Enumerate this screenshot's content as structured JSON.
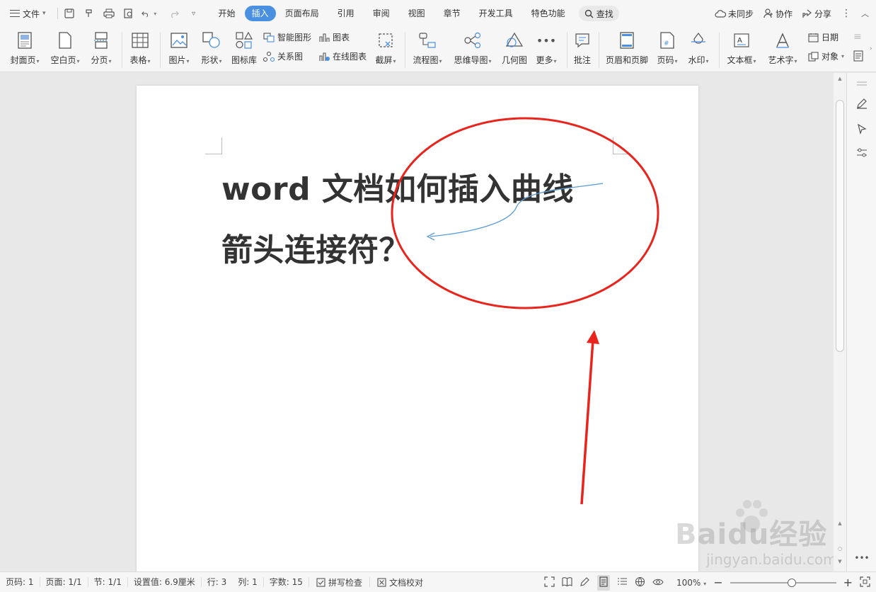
{
  "menubar": {
    "file_label": "文件",
    "tabs": [
      {
        "label": "开始"
      },
      {
        "label": "插入"
      },
      {
        "label": "页面布局"
      },
      {
        "label": "引用"
      },
      {
        "label": "审阅"
      },
      {
        "label": "视图"
      },
      {
        "label": "章节"
      },
      {
        "label": "开发工具"
      },
      {
        "label": "特色功能"
      }
    ],
    "active_tab": "插入",
    "search_label": "查找",
    "sync_label": "未同步",
    "collab_label": "协作",
    "share_label": "分享"
  },
  "ribbon": {
    "cover_page": "封面页",
    "blank_page": "空白页",
    "page_break": "分页",
    "table": "表格",
    "picture": "图片",
    "shape": "形状",
    "icon_library": "图标库",
    "smart_graphic": "智能图形",
    "relation_chart": "关系图",
    "chart": "图表",
    "online_chart": "在线图表",
    "screenshot": "截屏",
    "flowchart": "流程图",
    "mindmap": "思维导图",
    "geometry": "几何图",
    "more": "更多",
    "comment": "批注",
    "header_footer": "页眉和页脚",
    "page_number": "页码",
    "watermark": "水印",
    "textbox": "文本框",
    "wordart": "艺术字",
    "date": "日期",
    "object": "对象"
  },
  "document": {
    "line1": "word 文档如何插入曲线",
    "line2": "箭头连接符？"
  },
  "statusbar": {
    "page_num": "页码: 1",
    "pages": "页面: 1/1",
    "section": "节: 1/1",
    "setting": "设置值: 6.9厘米",
    "row": "行: 3",
    "col": "列: 1",
    "word_count": "字数: 15",
    "spell_check": "拼写检查",
    "doc_proof": "文档校对",
    "zoom": "100%",
    "zoom_level": 100
  },
  "watermark": {
    "brand": "Baidu经验",
    "url": "jingyan.baidu.com"
  },
  "colors": {
    "accent": "#4a90e2",
    "annotation_red": "#e8241c",
    "curve_blue": "#5b9bd5"
  }
}
